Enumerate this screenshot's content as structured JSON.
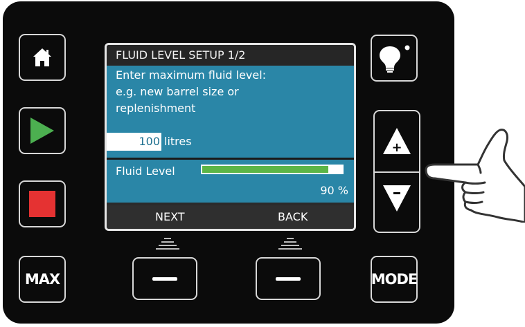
{
  "screen": {
    "title": "FLUID LEVEL SETUP 1/2",
    "instruction_lines": [
      "Enter maximum fluid level:",
      "e.g. new barrel size or",
      "replenishment"
    ],
    "input_value": "100",
    "input_unit": "litres",
    "fluid_level_label": "Fluid Level",
    "fluid_level_fraction": 0.9,
    "fluid_level_percent": "90 %",
    "softkey_left": "NEXT",
    "softkey_right": "BACK"
  },
  "buttons": {
    "home": "home-icon",
    "play": "play-icon",
    "stop": "stop-icon",
    "max_label": "MAX",
    "light": "lightbulb-icon",
    "up_symbol": "+",
    "down_symbol": "-",
    "mode_label": "MODE"
  },
  "colors": {
    "panel": "#0b0b0b",
    "screen_accent": "#2a86a7",
    "play": "#4caf50",
    "stop": "#e53232",
    "level_fill": "#5cb547"
  }
}
